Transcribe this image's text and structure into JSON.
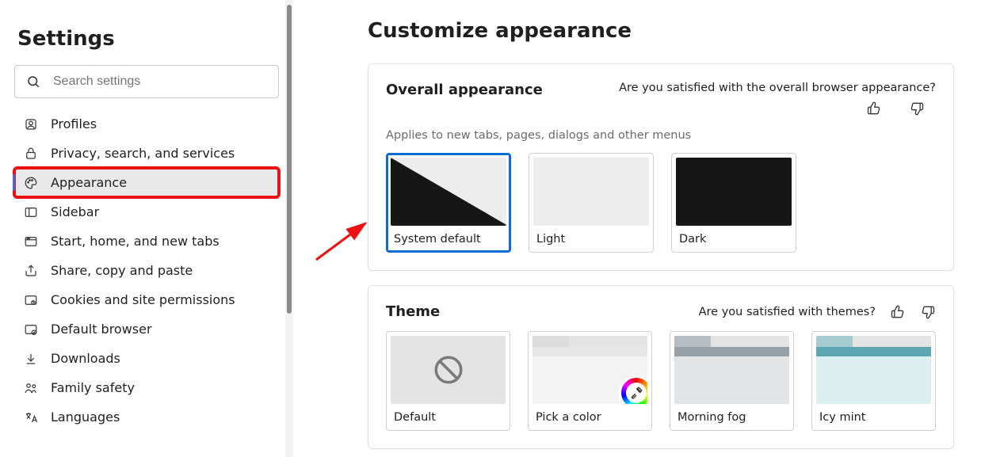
{
  "sidebar": {
    "title": "Settings",
    "search_placeholder": "Search settings",
    "items": [
      {
        "label": "Profiles",
        "icon": "profile-icon"
      },
      {
        "label": "Privacy, search, and services",
        "icon": "lock-icon"
      },
      {
        "label": "Appearance",
        "icon": "palette-icon",
        "active": true,
        "highlighted": true
      },
      {
        "label": "Sidebar",
        "icon": "sidebar-icon"
      },
      {
        "label": "Start, home, and new tabs",
        "icon": "home-icon"
      },
      {
        "label": "Share, copy and paste",
        "icon": "share-icon"
      },
      {
        "label": "Cookies and site permissions",
        "icon": "cookies-icon"
      },
      {
        "label": "Default browser",
        "icon": "browser-icon"
      },
      {
        "label": "Downloads",
        "icon": "download-icon"
      },
      {
        "label": "Family safety",
        "icon": "family-icon"
      },
      {
        "label": "Languages",
        "icon": "languages-icon"
      }
    ]
  },
  "main": {
    "title": "Customize appearance",
    "overall": {
      "title": "Overall appearance",
      "feedback_prompt": "Are you satisfied with the overall browser appearance?",
      "subtext": "Applies to new tabs, pages, dialogs and other menus",
      "options": [
        {
          "label": "System default",
          "kind": "sysdefault",
          "selected": true
        },
        {
          "label": "Light",
          "kind": "light"
        },
        {
          "label": "Dark",
          "kind": "dark"
        }
      ]
    },
    "theme": {
      "title": "Theme",
      "feedback_prompt": "Are you satisfied with themes?",
      "options": [
        {
          "label": "Default",
          "kind": "default"
        },
        {
          "label": "Pick a color",
          "kind": "pick"
        },
        {
          "label": "Morning fog",
          "kind": "fog"
        },
        {
          "label": "Icy mint",
          "kind": "icy"
        }
      ]
    }
  }
}
